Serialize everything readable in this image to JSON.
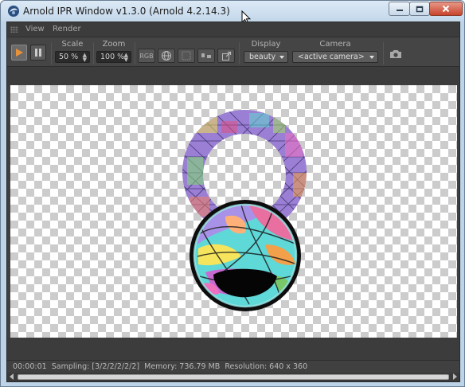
{
  "window": {
    "title": "Arnold IPR Window v1.3.0 (Arnold 4.2.14.3)"
  },
  "menubar": {
    "items": [
      "View",
      "Render"
    ]
  },
  "toolbar": {
    "scale_label": "Scale",
    "scale_value": "50 %",
    "zoom_label": "Zoom",
    "zoom_value": "100 %",
    "rgb_button": "RGB",
    "display_label": "Display",
    "display_value": "beauty",
    "camera_label": "Camera",
    "camera_value": "<active camera>"
  },
  "icons": {
    "play": "play-icon",
    "pause": "pause-icon",
    "globe": "globe-icon",
    "grid": "grid-icon",
    "compare": "compare-icon",
    "export": "export-icon",
    "snapshot": "camera-icon"
  },
  "colors": {
    "play_accent": "#e8923a",
    "background": "#3f3f3f",
    "titlebar": "#c3d7ea"
  },
  "status": {
    "time": "00:00:01",
    "sampling": "Sampling: [3/2/2/2/2/2]",
    "memory": "Memory: 736.79 MB",
    "resolution": "Resolution: 640 x 360"
  }
}
